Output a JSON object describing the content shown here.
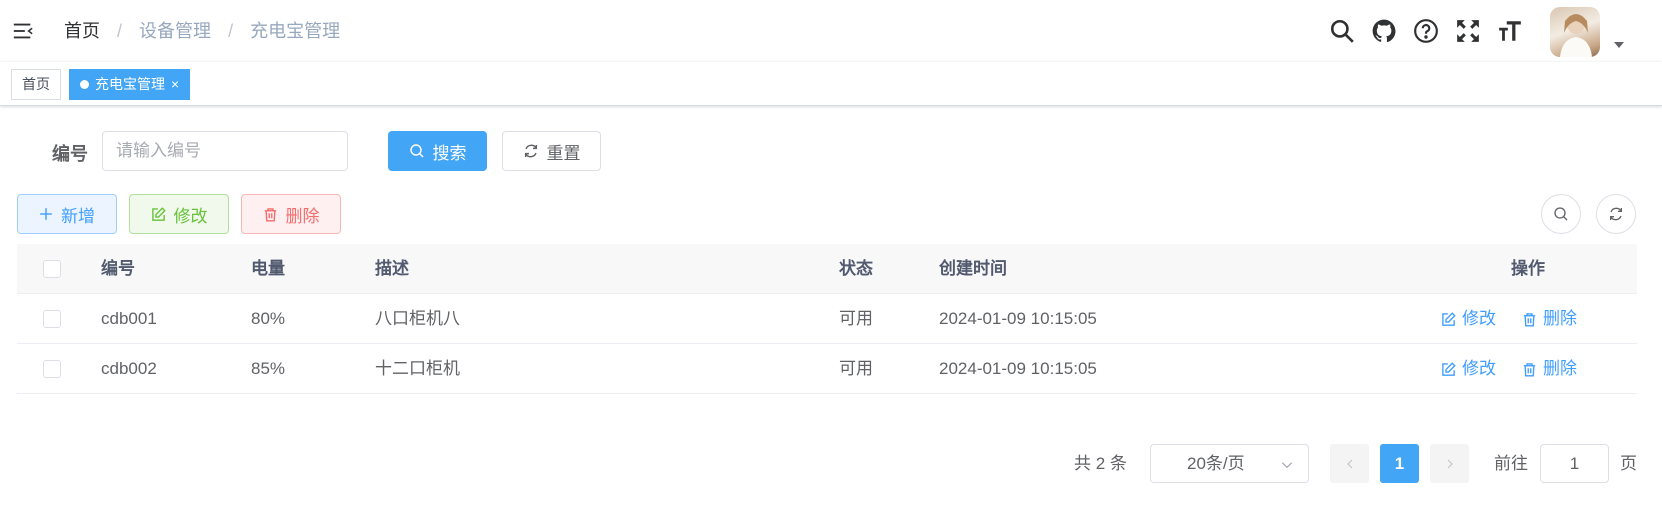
{
  "breadcrumb": {
    "home": "首页",
    "section": "设备管理",
    "current": "充电宝管理",
    "separator": "/"
  },
  "header_icons": [
    "menu-fold-icon",
    "search-icon",
    "github-icon",
    "help-icon",
    "fullscreen-icon",
    "font-size-icon"
  ],
  "tags": {
    "home": "首页",
    "active": "充电宝管理",
    "close": "×"
  },
  "search": {
    "label": "编号",
    "placeholder": "请输入编号",
    "value": "",
    "search_button": "搜索",
    "reset_button": "重置"
  },
  "toolbar": {
    "add": "新增",
    "edit": "修改",
    "delete": "删除"
  },
  "table": {
    "headers": {
      "code": "编号",
      "power": "电量",
      "description": "描述",
      "status": "状态",
      "created_at": "创建时间",
      "actions": "操作"
    },
    "rows": [
      {
        "code": "cdb001",
        "power": "80%",
        "description": "八口柜机八",
        "status": "可用",
        "created_at": "2024-01-09 10:15:05",
        "edit": "修改",
        "delete": "删除"
      },
      {
        "code": "cdb002",
        "power": "85%",
        "description": "十二口柜机",
        "status": "可用",
        "created_at": "2024-01-09 10:15:05",
        "edit": "修改",
        "delete": "删除"
      }
    ]
  },
  "pagination": {
    "total": "共 2 条",
    "page_size": "20条/页",
    "current_page": "1",
    "goto_label": "前往",
    "goto_value": "1",
    "page_suffix": "页"
  },
  "colors": {
    "primary": "#42a5f5",
    "success": "#67c23a",
    "danger": "#f56c6c",
    "link": "#409eff"
  }
}
